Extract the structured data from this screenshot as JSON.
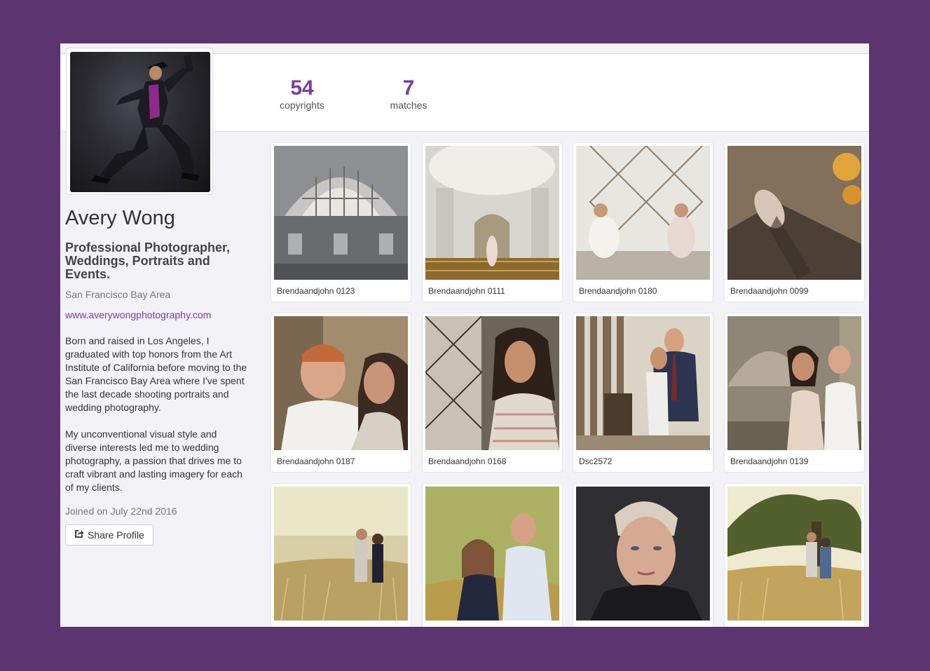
{
  "stats": [
    {
      "value": "54",
      "label": "copyrights"
    },
    {
      "value": "7",
      "label": "matches"
    }
  ],
  "profile": {
    "name": "Avery Wong",
    "headline": "Professional Photographer, Weddings, Portraits and Events.",
    "location": "San Francisco Bay Area",
    "website": "www.averywongphotography.com",
    "bio": [
      "Born and raised in Los Angeles, I graduated with top honors from the Art Institute of California before moving to the San Francisco Bay Area where I've spent the last decade shooting portraits and wedding photography.",
      "My unconventional visual style and diverse interests led me to wedding photography, a passion that drives me to craft vibrant and lasting imagery for each of my clients."
    ],
    "joined": "Joined on July 22nd 2016",
    "share_label": "Share Profile",
    "share_icon": "share-icon"
  },
  "photos": [
    {
      "caption": "Brendaandjohn 0123"
    },
    {
      "caption": "Brendaandjohn 0111"
    },
    {
      "caption": "Brendaandjohn 0180"
    },
    {
      "caption": "Brendaandjohn 0099"
    },
    {
      "caption": "Brendaandjohn 0187"
    },
    {
      "caption": "Brendaandjohn 0168"
    },
    {
      "caption": "Dsc2572"
    },
    {
      "caption": "Brendaandjohn 0139"
    },
    {
      "caption": ""
    },
    {
      "caption": ""
    },
    {
      "caption": ""
    },
    {
      "caption": ""
    }
  ],
  "colors": {
    "accent": "#7a3c9e",
    "page_background": "#5b3470"
  }
}
